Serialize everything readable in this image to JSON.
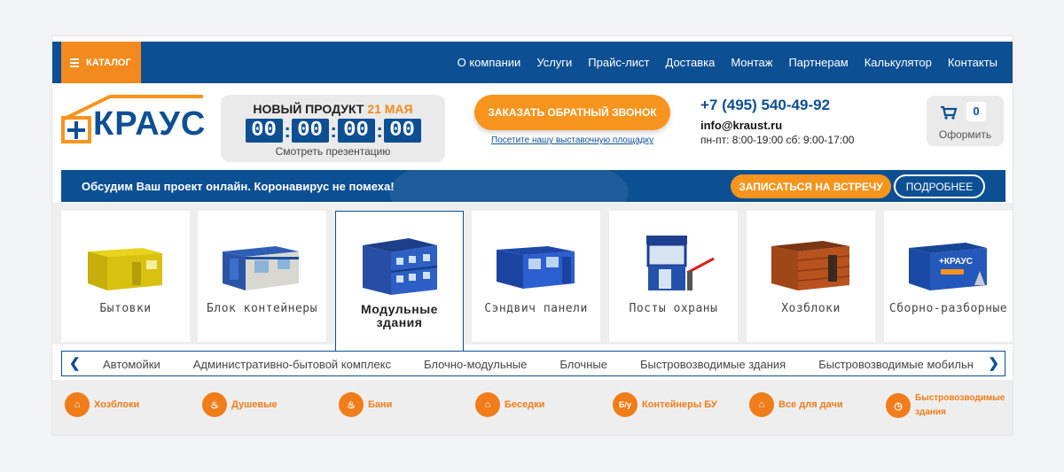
{
  "colors": {
    "brand_blue": "#0d4f93",
    "accent_orange": "#f7941d"
  },
  "topnav": {
    "catalog_label": "КАТАЛОГ",
    "links": [
      "О компании",
      "Услуги",
      "Прайс-лист",
      "Доставка",
      "Монтаж",
      "Партнерам",
      "Калькулятор",
      "Контакты"
    ]
  },
  "logo": {
    "text": "КРАУС"
  },
  "promo": {
    "title": "НОВЫЙ ПРОДУКТ",
    "date": "21 МАЯ",
    "timer": [
      "00",
      "00",
      "00",
      "00"
    ],
    "link": "Смотреть презентацию"
  },
  "callback": {
    "button": "ЗАКАЗАТЬ ОБРАТНЫЙ ЗВОНОК",
    "link": "Посетите нашу выставочную площадку"
  },
  "contacts": {
    "phone": "+7 (495) 540-49-92",
    "email": "info@kraust.ru",
    "hours": "пн-пт: 8:00-19:00 сб: 9:00-17:00"
  },
  "cart": {
    "count": "0",
    "label": "Оформить",
    "icon": "cart-icon"
  },
  "banner": {
    "text": "Обсудим Ваш проект онлайн. Коронавирус не помеха!",
    "meet_button": "ЗАПИСАТЬСЯ НА ВСТРЕЧУ",
    "more_button": "ПОДРОБНЕЕ"
  },
  "categories": [
    {
      "label": "Бытовки"
    },
    {
      "label": "Блок контейнеры"
    },
    {
      "label": "Модульные здания"
    },
    {
      "label": "Сэндвич панели"
    },
    {
      "label": "Посты охраны"
    },
    {
      "label": "Хозблоки"
    },
    {
      "label": "Сборно-разборные"
    }
  ],
  "subnav": [
    "Автомойки",
    "Административно-бытовой комплекс",
    "Блочно-модульные",
    "Блочные",
    "Быстровозводимые здания",
    "Быстровозводимые мобильн"
  ],
  "quick": [
    {
      "label": "Хозблоки",
      "icon": "shed-icon"
    },
    {
      "label": "Душевые",
      "icon": "shower-icon"
    },
    {
      "label": "Бани",
      "icon": "sauna-icon"
    },
    {
      "label": "Беседки",
      "icon": "gazebo-icon"
    },
    {
      "label": "Контейнеры БУ",
      "icon": "used-icon",
      "badge": "Б/у"
    },
    {
      "label": "Все для дачи",
      "icon": "house-icon"
    },
    {
      "label": "Быстровозводимые здания",
      "icon": "clock-icon"
    }
  ]
}
